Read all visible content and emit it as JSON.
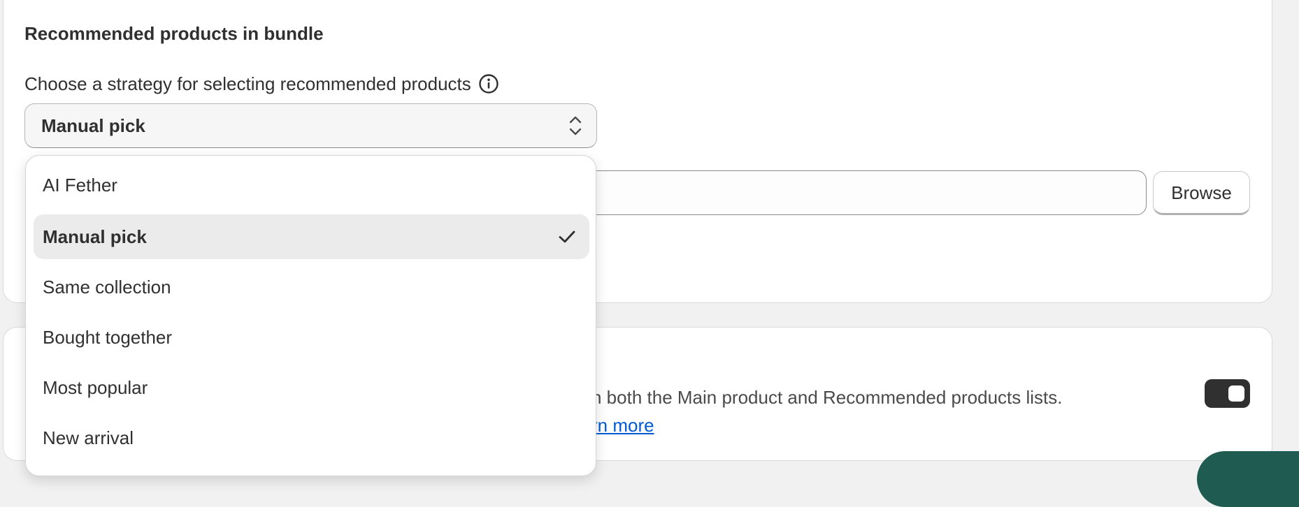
{
  "section": {
    "title": "Recommended products in bundle",
    "strategy_label": "Choose a strategy for selecting recommended products",
    "info_icon": "info-circle-icon"
  },
  "strategy_select": {
    "value": "Manual pick",
    "icon": "select-chevron-icon",
    "options": [
      {
        "label": "AI Fether",
        "selected": false
      },
      {
        "label": "Manual pick",
        "selected": true
      },
      {
        "label": "Same collection",
        "selected": false
      },
      {
        "label": "Bought together",
        "selected": false
      },
      {
        "label": "Most popular",
        "selected": false
      },
      {
        "label": "New arrival",
        "selected": false
      }
    ],
    "check_icon": "checkmark-icon"
  },
  "product_search": {
    "value": "",
    "browse_label": "Browse"
  },
  "second_card": {
    "description": "n both the Main product and Recommended products lists.",
    "link_text": "rn more",
    "toggle_on": true
  },
  "colors": {
    "link": "#005bd3",
    "toggle_on": "#303030",
    "selected_option_bg": "#ebebeb",
    "fab": "#1f5b50"
  }
}
